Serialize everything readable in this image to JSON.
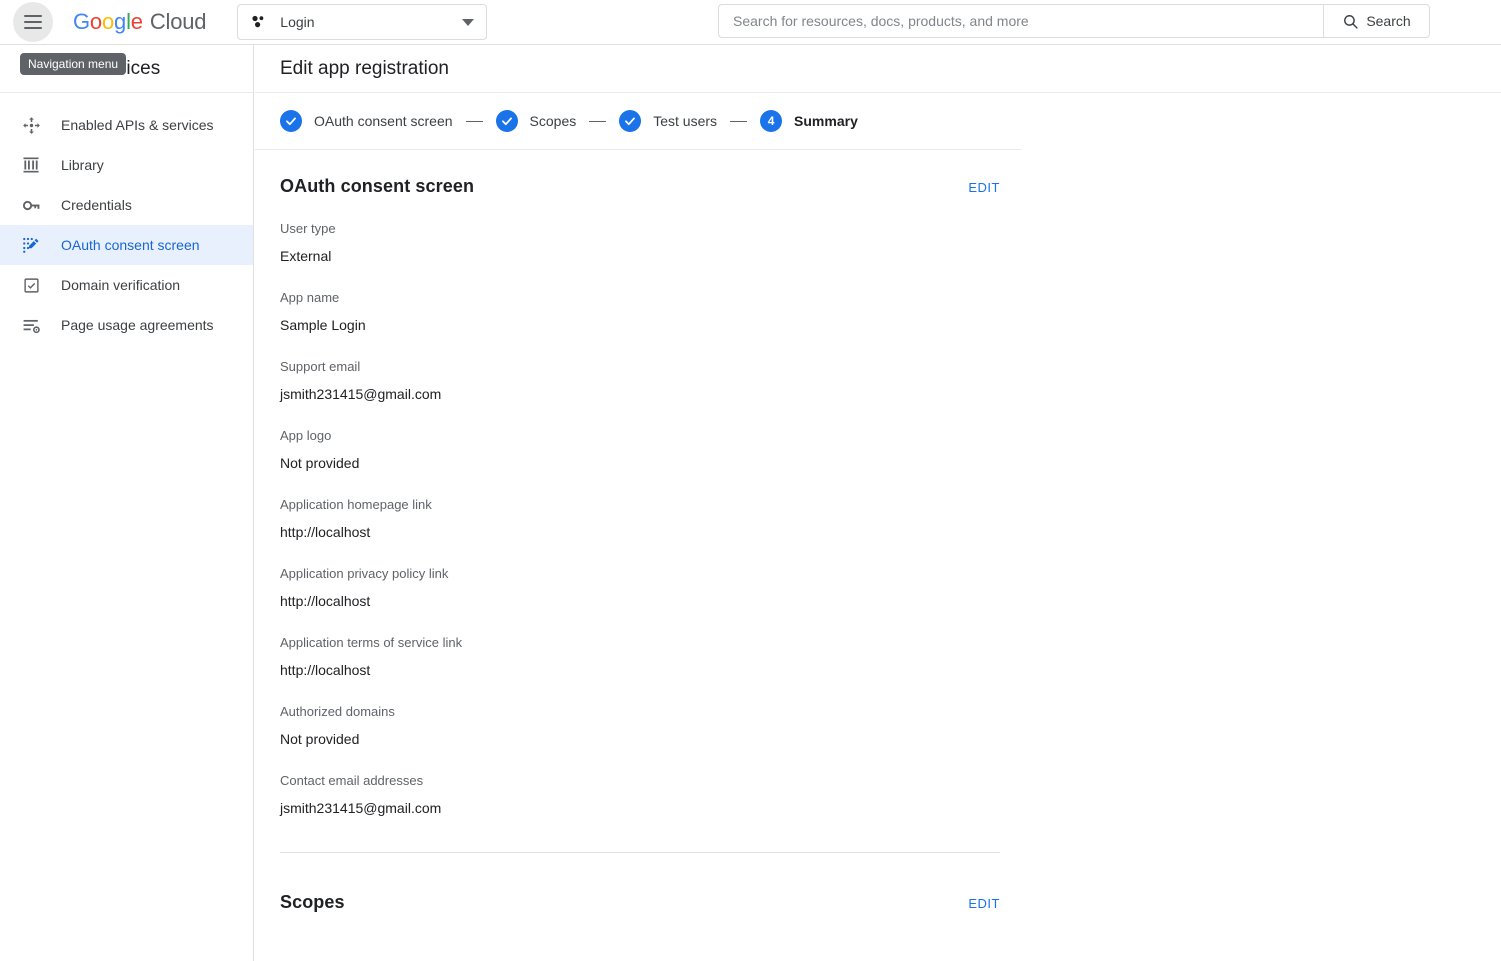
{
  "topbar": {
    "menu_icon": "hamburger-icon",
    "brand": {
      "g1": "G",
      "g2": "o",
      "g3": "o",
      "g4": "g",
      "g5": "l",
      "g6": "e",
      "suffix": "Cloud"
    },
    "project_selector": {
      "icon": "project-dots-icon",
      "value": "Login",
      "caret_icon": "chevron-down-icon"
    },
    "search": {
      "placeholder": "Search for resources, docs, products, and more",
      "value": "",
      "button_label": "Search",
      "button_icon": "search-icon"
    }
  },
  "tooltip": {
    "text": "Navigation menu"
  },
  "sidebar": {
    "title": "APIs & Services",
    "items": [
      {
        "label": "Enabled APIs & services",
        "icon": "api-icon",
        "active": false
      },
      {
        "label": "Library",
        "icon": "library-icon",
        "active": false
      },
      {
        "label": "Credentials",
        "icon": "key-icon",
        "active": false
      },
      {
        "label": "OAuth consent screen",
        "icon": "consent-screen-icon",
        "active": true
      },
      {
        "label": "Domain verification",
        "icon": "checkbox-icon",
        "active": false
      },
      {
        "label": "Page usage agreements",
        "icon": "list-gear-icon",
        "active": false
      }
    ]
  },
  "main": {
    "page_title": "Edit app registration",
    "stepper": [
      {
        "label": "OAuth consent screen",
        "state": "complete",
        "badge": "check-icon"
      },
      {
        "label": "Scopes",
        "state": "complete",
        "badge": "check-icon"
      },
      {
        "label": "Test users",
        "state": "complete",
        "badge": "check-icon"
      },
      {
        "label": "Summary",
        "state": "current",
        "badge": "4"
      }
    ],
    "sections": [
      {
        "title": "OAuth consent screen",
        "edit_label": "EDIT",
        "fields": [
          {
            "label": "User type",
            "value": "External"
          },
          {
            "label": "App name",
            "value": "Sample Login"
          },
          {
            "label": "Support email",
            "value": "jsmith231415@gmail.com"
          },
          {
            "label": "App logo",
            "value": "Not provided"
          },
          {
            "label": "Application homepage link",
            "value": "http://localhost"
          },
          {
            "label": "Application privacy policy link",
            "value": "http://localhost"
          },
          {
            "label": "Application terms of service link",
            "value": "http://localhost"
          },
          {
            "label": "Authorized domains",
            "value": "Not provided"
          },
          {
            "label": "Contact email addresses",
            "value": "jsmith231415@gmail.com"
          }
        ]
      },
      {
        "title": "Scopes",
        "edit_label": "EDIT",
        "fields": []
      }
    ]
  },
  "colors": {
    "accent": "#1a73e8",
    "accent_text": "#1967d2",
    "active_bg": "#e8f0fe",
    "border": "#e0e0e0",
    "label_grey": "#5f6368",
    "body_text": "#202124"
  }
}
